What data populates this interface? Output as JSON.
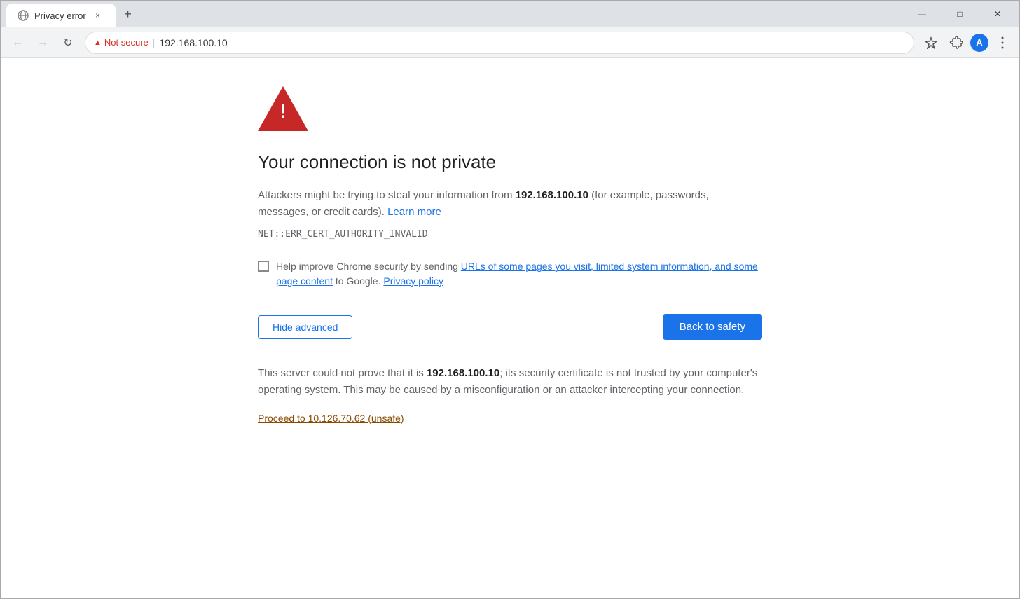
{
  "browser": {
    "tab_title": "Privacy error",
    "tab_close_label": "×",
    "new_tab_label": "+",
    "win_minimize": "—",
    "win_maximize": "□",
    "win_close": "✕",
    "back_disabled": true,
    "forward_disabled": true,
    "not_secure_label": "Not secure",
    "address_separator": "|",
    "address_url": "192.168.100.10",
    "avatar_letter": "A"
  },
  "page": {
    "error_code": "NET::ERR_CERT_AUTHORITY_INVALID",
    "title": "Your connection is not private",
    "description_before": "Attackers might be trying to steal your information from ",
    "description_host": "192.168.100.10",
    "description_after": " (for example, passwords, messages, or credit cards).",
    "learn_more_label": "Learn more",
    "checkbox_before": "Help improve Chrome security by sending ",
    "checkbox_link": "URLs of some pages you visit, limited system information, and some page content",
    "checkbox_after": " to Google.",
    "privacy_policy_label": "Privacy policy",
    "hide_advanced_label": "Hide advanced",
    "back_to_safety_label": "Back to safety",
    "advanced_text_before": "This server could not prove that it is ",
    "advanced_host": "192.168.100.10",
    "advanced_text_after": "; its security certificate is not trusted by your computer's operating system. This may be caused by a misconfiguration or an attacker intercepting your connection.",
    "proceed_label": "Proceed to 10.126.70.62 (unsafe)"
  }
}
